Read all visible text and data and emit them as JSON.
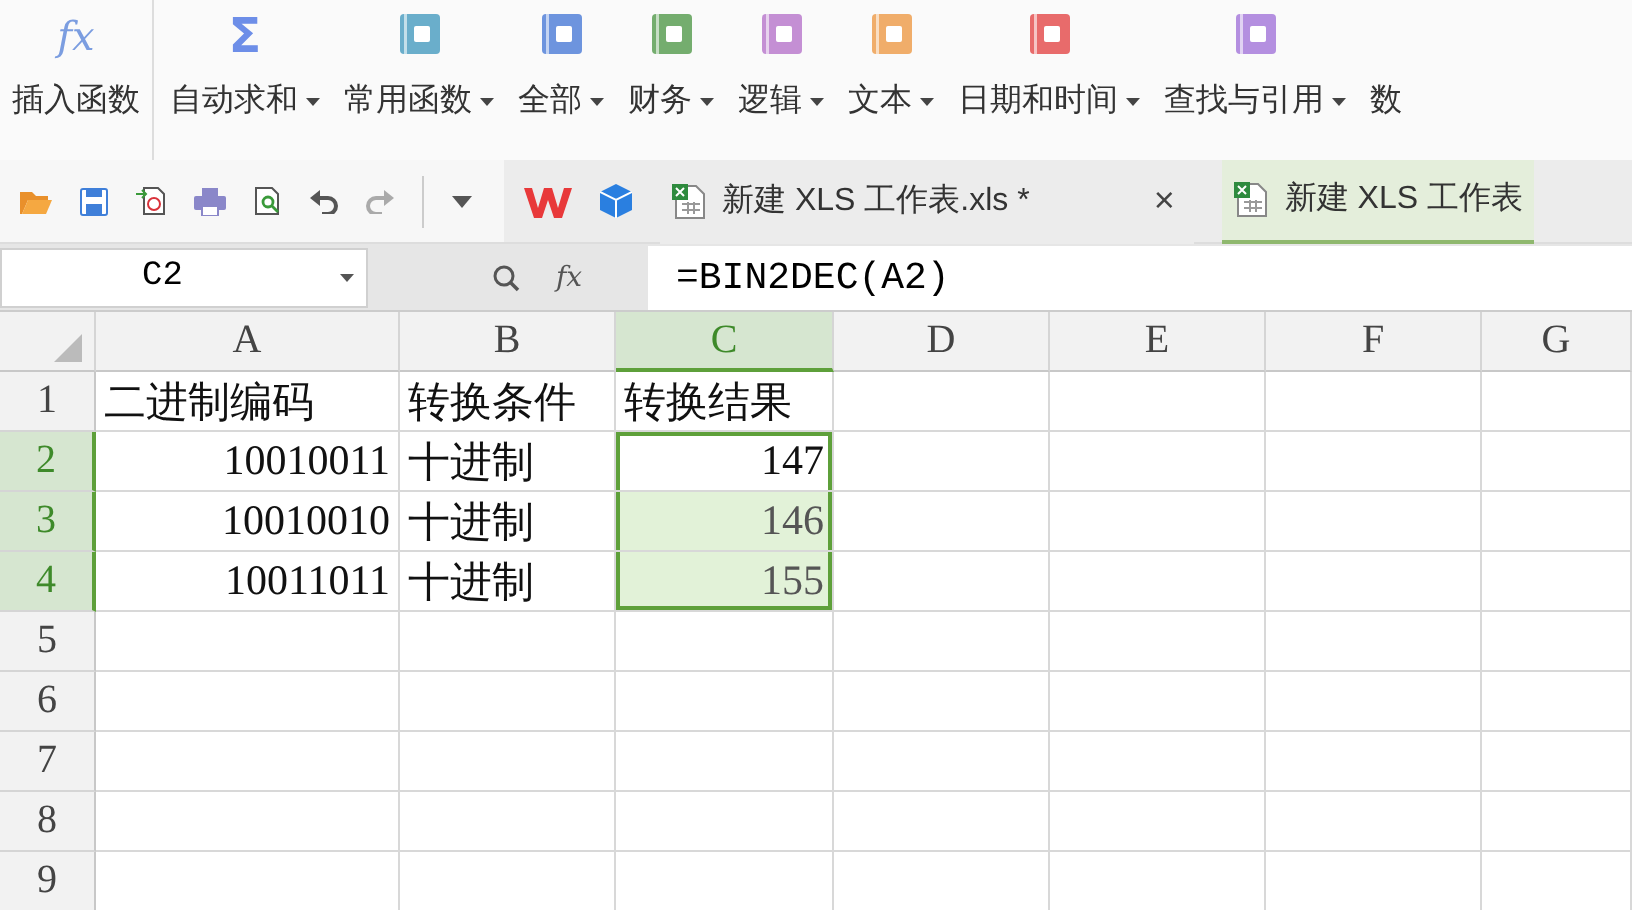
{
  "ribbon": {
    "items": [
      {
        "kind": "glyph",
        "icon": "fx",
        "label": "插入函数",
        "dropdown": false
      },
      {
        "kind": "glyph",
        "icon": "Σ",
        "label": "自动求和",
        "dropdown": true
      },
      {
        "kind": "book",
        "label": "常用函数",
        "dropdown": true
      },
      {
        "kind": "book",
        "label": "全部",
        "dropdown": true
      },
      {
        "kind": "book",
        "label": "财务",
        "dropdown": true
      },
      {
        "kind": "book",
        "label": "逻辑",
        "dropdown": true
      },
      {
        "kind": "book",
        "label": "文本",
        "dropdown": true
      },
      {
        "kind": "book",
        "label": "日期和时间",
        "dropdown": true
      },
      {
        "kind": "book",
        "label": "查找与引用",
        "dropdown": true
      },
      {
        "kind": "text",
        "label": "数",
        "dropdown": false
      }
    ]
  },
  "tabs": [
    {
      "label": "新建 XLS 工作表.xls *",
      "close": "×",
      "selected": false
    },
    {
      "label": "新建 XLS 工作表",
      "selected": true
    }
  ],
  "formula_bar": {
    "name_box": "C2",
    "fx": "fx",
    "formula": "=BIN2DEC(A2)"
  },
  "sheet": {
    "columns": [
      {
        "label": "A",
        "selected": false
      },
      {
        "label": "B",
        "selected": false
      },
      {
        "label": "C",
        "selected": true
      },
      {
        "label": "D",
        "selected": false
      },
      {
        "label": "E",
        "selected": false
      },
      {
        "label": "F",
        "selected": false
      },
      {
        "label": "G",
        "selected": false
      }
    ],
    "rows": [
      {
        "label": "1",
        "selected": false,
        "cells": [
          {
            "text": "二进制编码",
            "kind": "text",
            "selected": false,
            "active": false
          },
          {
            "text": "转换条件",
            "kind": "text",
            "selected": false,
            "active": false
          },
          {
            "text": "转换结果",
            "kind": "text",
            "selected": false,
            "active": false
          }
        ]
      },
      {
        "label": "2",
        "selected": true,
        "cells": [
          {
            "text": "10010011",
            "kind": "number",
            "selected": false,
            "active": false
          },
          {
            "text": "十进制",
            "kind": "text",
            "selected": false,
            "active": false
          },
          {
            "text": "147",
            "kind": "number",
            "selected": true,
            "active": true
          }
        ]
      },
      {
        "label": "3",
        "selected": true,
        "cells": [
          {
            "text": "10010010",
            "kind": "number",
            "selected": false,
            "active": false
          },
          {
            "text": "十进制",
            "kind": "text",
            "selected": false,
            "active": false
          },
          {
            "text": "146",
            "kind": "number",
            "selected": true,
            "active": false
          }
        ]
      },
      {
        "label": "4",
        "selected": true,
        "cells": [
          {
            "text": "10011011",
            "kind": "number",
            "selected": false,
            "active": false
          },
          {
            "text": "十进制",
            "kind": "text",
            "selected": false,
            "active": false
          },
          {
            "text": "155",
            "kind": "number",
            "selected": true,
            "active": false
          }
        ]
      },
      {
        "label": "5",
        "selected": false
      },
      {
        "label": "6",
        "selected": false
      },
      {
        "label": "7",
        "selected": false
      },
      {
        "label": "8",
        "selected": false
      },
      {
        "label": "9",
        "selected": false
      }
    ]
  }
}
